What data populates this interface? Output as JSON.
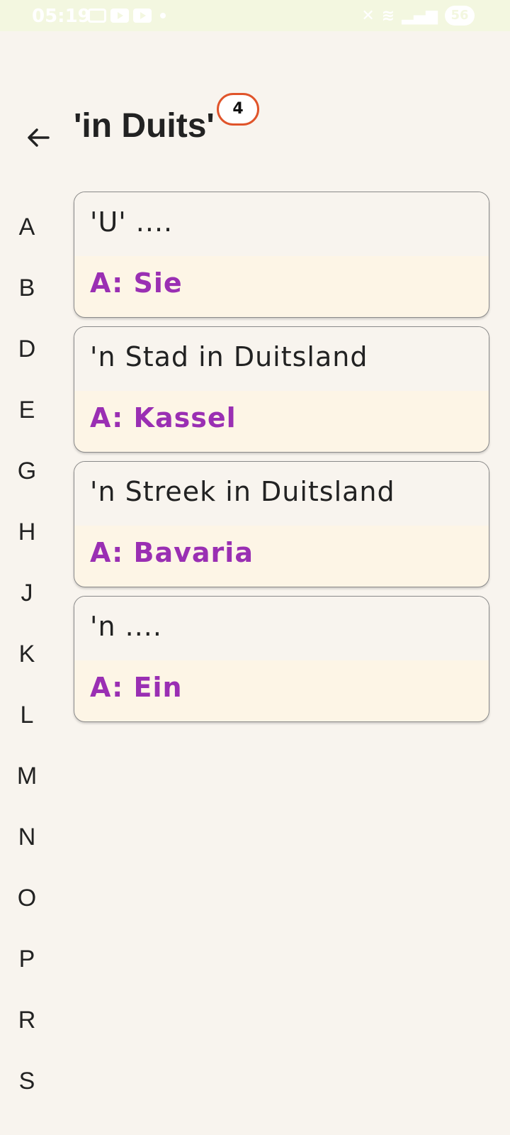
{
  "status_bar": {
    "time": "05:19",
    "battery": "56"
  },
  "header": {
    "back_icon": "arrow-left-icon",
    "title": "'in Duits'",
    "count": "4"
  },
  "index_letters": [
    "A",
    "B",
    "D",
    "E",
    "G",
    "H",
    "J",
    "K",
    "L",
    "M",
    "N",
    "O",
    "P",
    "R",
    "S"
  ],
  "cards": [
    {
      "question": "'U' ....",
      "answer": "A: Sie"
    },
    {
      "question": "'n Stad in Duitsland",
      "answer": "A: Kassel"
    },
    {
      "question": "'n Streek in Duitsland",
      "answer": "A: Bavaria"
    },
    {
      "question": "'n ....",
      "answer": "A: Ein"
    }
  ],
  "colors": {
    "background": "#f8f4ee",
    "answer_text": "#9a2fb3",
    "badge_border": "#e0542a",
    "status_bar": "#f3f7e0"
  }
}
